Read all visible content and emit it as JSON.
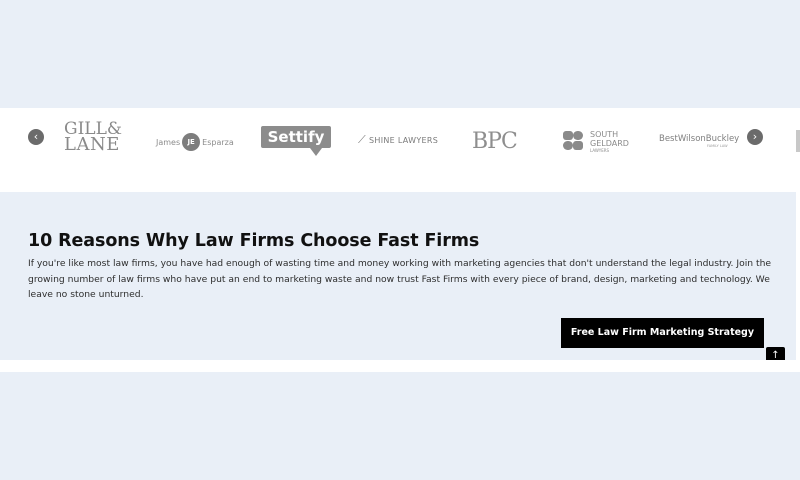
{
  "carousel": {
    "prev_icon": "‹",
    "next_icon": "›",
    "logos": {
      "gill_lane": {
        "line1": "GILL&",
        "line2": "LANE"
      },
      "james_esparza": {
        "left": "James",
        "monogram": "JE",
        "right": "Esparza"
      },
      "settify": {
        "text": "Settify"
      },
      "shine": {
        "text": "SHINE LAWYERS"
      },
      "bpc": {
        "text": "BPC"
      },
      "south_geldard": {
        "line1": "SOUTH",
        "line2": "GELDARD",
        "line3": "LAWYERS"
      },
      "bwb": {
        "text": "BestWilsonBuckley",
        "sub": "FAMILY LAW"
      }
    }
  },
  "main": {
    "heading": "10 Reasons Why Law Firms Choose Fast Firms",
    "body": "If you're like most law firms, you have had enough of wasting time and money working with marketing agencies that don't understand the legal industry. Join the growing number of law firms who have put an end to marketing waste and now trust Fast Firms with every piece of brand, design, marketing and technology. We leave no stone unturned.",
    "cta_label": "Free Law Firm Marketing Strategy"
  },
  "back_to_top": {
    "icon": "↑"
  }
}
